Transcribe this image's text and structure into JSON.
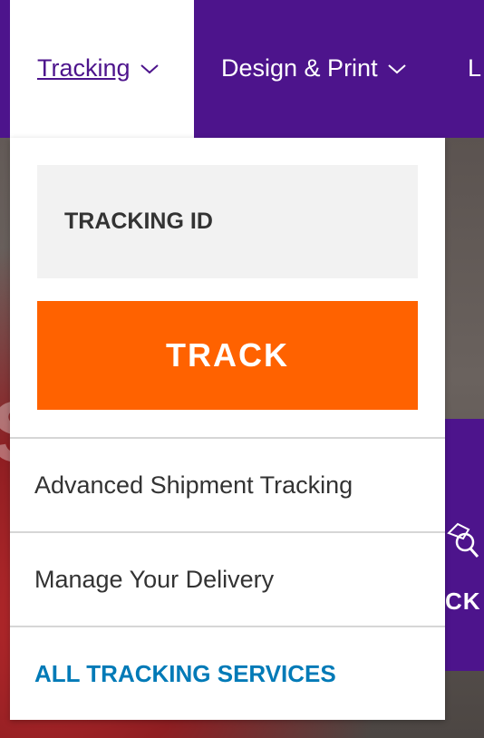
{
  "nav": {
    "tracking_label": "Tracking",
    "design_label": "Design & Print",
    "more_label": "L"
  },
  "dropdown": {
    "tracking_id_placeholder": "TRACKING ID",
    "track_button_label": "TRACK",
    "links": [
      {
        "label": "Advanced Shipment Tracking"
      },
      {
        "label": "Manage Your Delivery"
      }
    ],
    "all_services_label": "ALL TRACKING SERVICES"
  },
  "background": {
    "card_label": "CK"
  },
  "colors": {
    "brand_purple": "#4d148c",
    "track_orange": "#ff6200",
    "link_blue": "#007ab7"
  }
}
